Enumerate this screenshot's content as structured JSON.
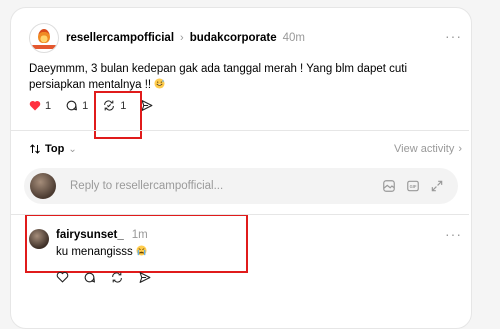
{
  "post": {
    "author": "resellercampofficial",
    "chevron": "›",
    "reply_to": "budakcorporate",
    "time": "40m",
    "more": "···",
    "text": "Daeymmm, 3 bulan kedepan gak ada tanggal merah ! Yang blm dapet cuti persiapkan mentalnya !!",
    "text_emoji": "grinning-sweat-emoji",
    "likes": "1",
    "comments": "1",
    "reposts": "1"
  },
  "sort": {
    "label": "Top",
    "view_activity": "View activity",
    "arrow": "›"
  },
  "reply": {
    "placeholder": "Reply to resellercampofficial..."
  },
  "comment": {
    "author": "fairysunset_",
    "time": "1m",
    "text": "ku menangisss",
    "text_emoji": "crying-emoji",
    "more": "···"
  },
  "colors": {
    "like_red": "#ff3040",
    "highlight_red": "#e01b1b",
    "muted": "#999999"
  }
}
